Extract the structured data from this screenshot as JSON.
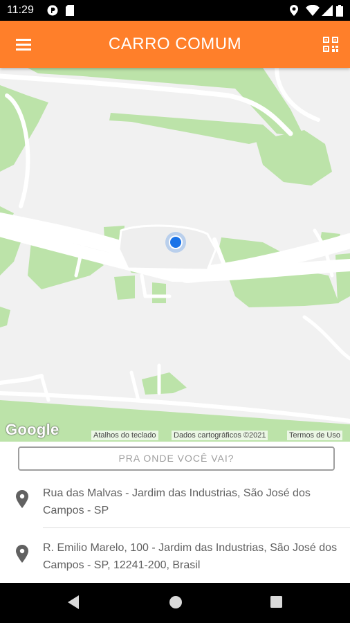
{
  "status_bar": {
    "time": "11:29"
  },
  "app_bar": {
    "title": "CARRO COMUM",
    "menu_icon": "hamburger-menu-icon",
    "qr_icon": "qr-code-icon"
  },
  "map": {
    "logo": "Google",
    "attribution": {
      "shortcuts": "Atalhos do teclado",
      "data": "Dados cartográficos ©2021",
      "terms": "Termos de Uso"
    }
  },
  "search": {
    "placeholder": "PRA ONDE VOCÊ VAI?"
  },
  "places": [
    {
      "address": "Rua das Malvas - Jardim das Industrias, São José dos Campos - SP"
    },
    {
      "address": "R. Emilio Marelo, 100 - Jardim das Industrias, São José dos Campos - SP, 12241-200, Brasil"
    }
  ],
  "colors": {
    "accent": "#FF7F2A",
    "park_green": "#BCE3A9",
    "location_dot": "#1A73E8"
  }
}
